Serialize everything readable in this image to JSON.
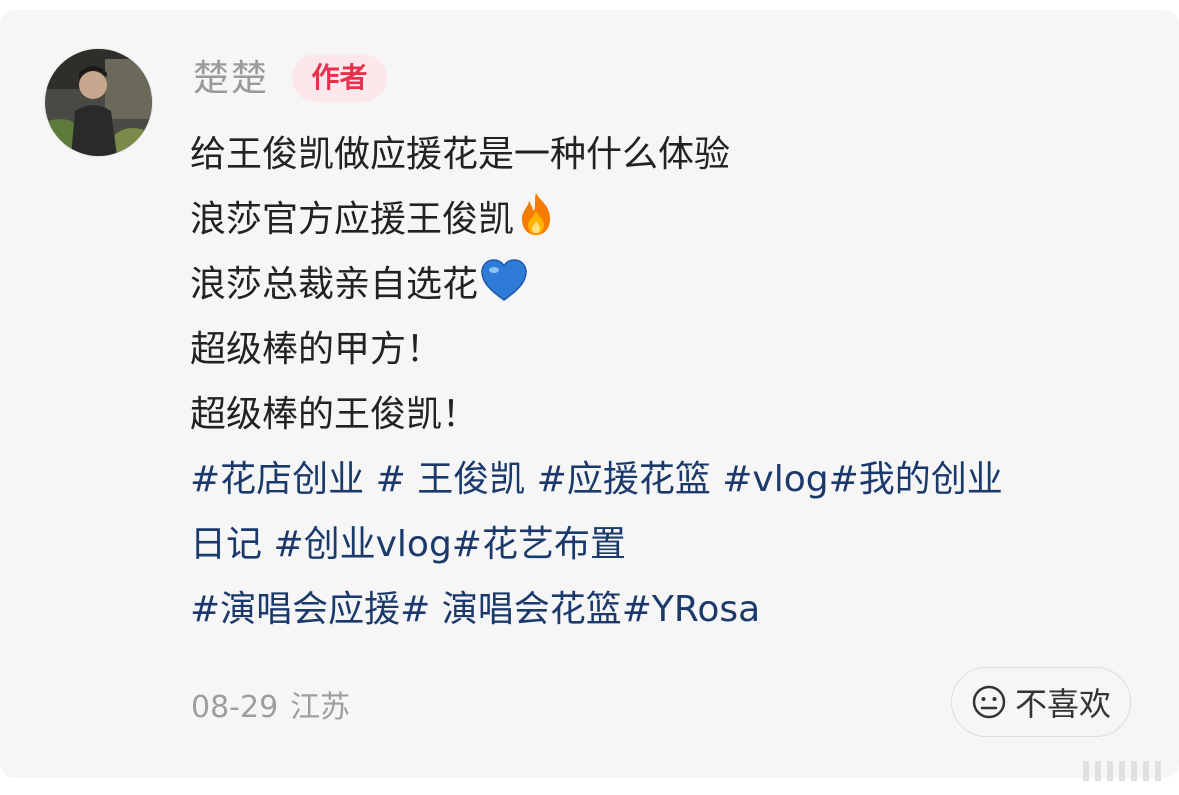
{
  "comment": {
    "author_name": "楚楚",
    "author_badge": "作者",
    "avatar_icon": "person-photo-avatar",
    "lines": [
      "给王俊凯做应援花是一种什么体验",
      "浪莎官方应援王俊凯",
      "浪莎总裁亲自选花",
      "超级棒的甲方！",
      "超级棒的王俊凯！"
    ],
    "emojis": {
      "line2": "fire-emoji",
      "line3": "blue-heart-emoji"
    },
    "hashtags": [
      "#花店创业 # 王俊凯 #应援花篮 #vlog#我的创业",
      "日记 #创业vlog#花艺布置",
      "#演唱会应援# 演唱会花篮#YRosa"
    ],
    "date": "08-29",
    "location": "江苏",
    "dislike_label": "不喜欢",
    "dislike_icon": "neutral-face-icon",
    "colors": {
      "badge_bg": "#fde7ea",
      "badge_text": "#e8324d",
      "hashtag": "#1b3a6b"
    }
  }
}
